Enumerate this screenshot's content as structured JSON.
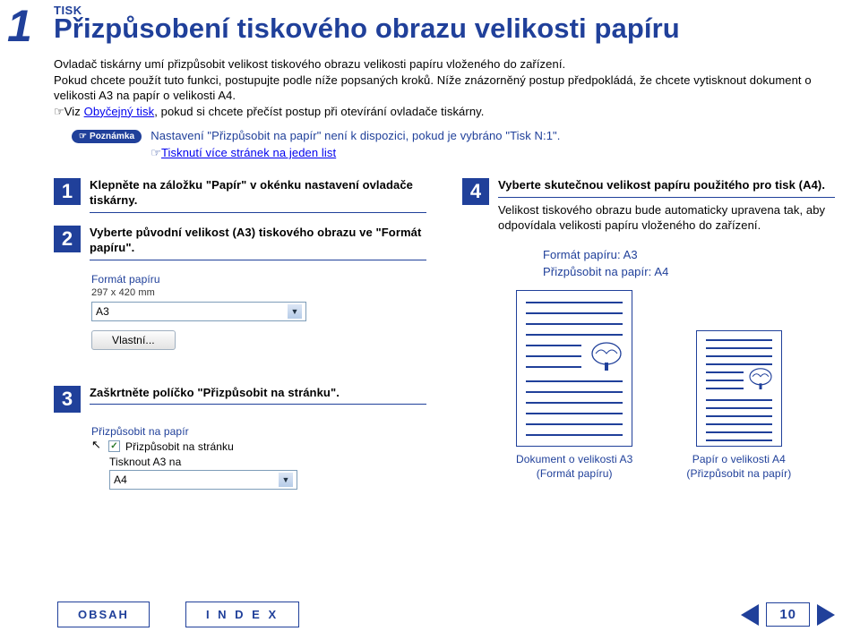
{
  "page_num_top": "1",
  "category": "TISK",
  "title": "Přizpůsobení tiskového obrazu velikosti papíru",
  "intro_p1": "Ovladač tiskárny umí přizpůsobit velikost tiskového obrazu velikosti papíru vloženého do zařízení.",
  "intro_p2": "Pokud chcete použít tuto funkci, postupujte podle níže popsaných kroků. Níže znázorněný postup předpokládá, že chcete vytisknout dokument o velikosti A3 na papír o velikosti A4.",
  "intro_hand": "☞",
  "intro_p3a": "Viz ",
  "intro_link1": "Obyčejný tisk",
  "intro_p3b": ", pokud si chcete přečíst postup při otevírání ovladače tiskárny.",
  "note_badge": "Poznámka",
  "note_line1": "Nastavení \"Přizpůsobit na papír\" není k dispozici, pokud je vybráno \"Tisk N:1\".",
  "note_hand": "☞",
  "note_link": "Tisknutí více stránek na jeden list",
  "steps": {
    "1": {
      "num": "1",
      "text": "Klepněte na záložku \"Papír\" v okénku nastavení ovladače tiskárny."
    },
    "2": {
      "num": "2",
      "text": "Vyberte původní velikost (A3) tiskového obrazu ve \"Formát papíru\"."
    },
    "3": {
      "num": "3",
      "text": "Zaškrtněte políčko \"Přizpůsobit na stránku\"."
    },
    "4": {
      "num": "4",
      "head": "Vyberte skutečnou velikost papíru použitého pro tisk (A4).",
      "body": "Velikost tiskového obrazu bude automaticky upravena tak, aby odpovídala velikosti papíru vloženého do zařízení."
    }
  },
  "ui_paperformat": {
    "label": "Formát papíru",
    "dim": "297 x 420 mm",
    "value": "A3",
    "custom_btn": "Vlastní..."
  },
  "ui_fit": {
    "label": "Přizpůsobit na papír",
    "opt_fit": "Přizpůsobit na stránku",
    "opt_na3": "Tisknout A3 na",
    "select_value": "A4"
  },
  "right_info": {
    "line1": "Formát papíru: A3",
    "line2": "Přizpůsobit na papír: A4"
  },
  "compare": {
    "a3_cap1": "Dokument o velikosti A3",
    "a3_cap2": "(Formát papíru)",
    "a4_cap1": "Papír o velikosti A4",
    "a4_cap2": "(Přizpůsobit na papír)"
  },
  "footer": {
    "obsah": "OBSAH",
    "index": "I N D E X",
    "page": "10"
  }
}
